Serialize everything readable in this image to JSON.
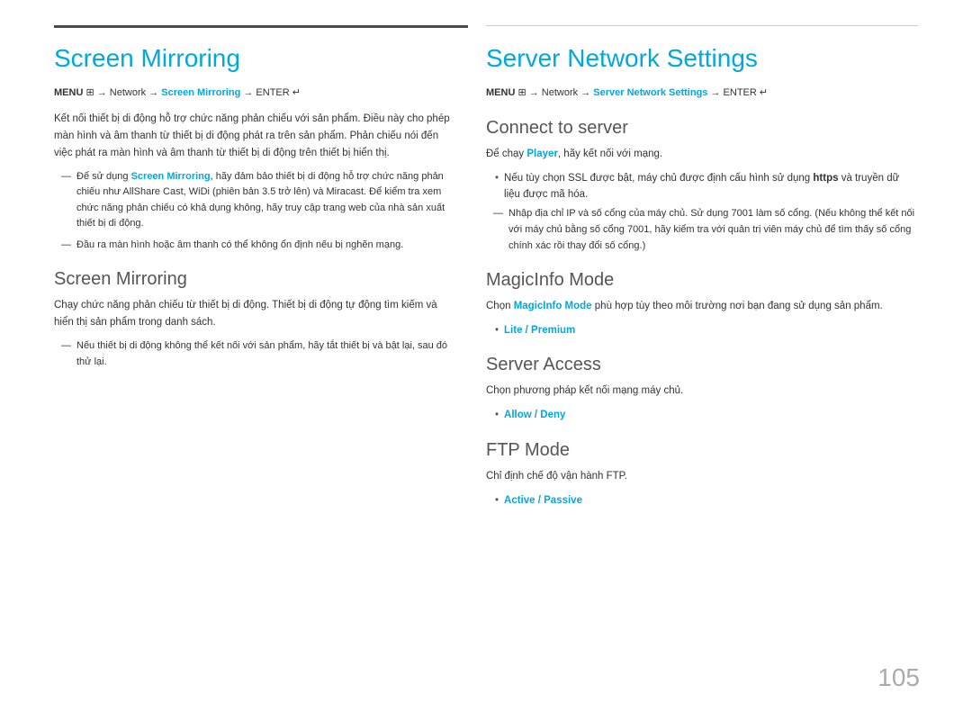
{
  "page": {
    "number": "105"
  },
  "left": {
    "top_bar_accent": true,
    "title": "Screen Mirroring",
    "menu_path": {
      "prefix": "MENU ",
      "menu_icon": "⊞",
      "path_parts": [
        "Network",
        "Screen Mirroring",
        "ENTER"
      ],
      "enter_icon": "↵"
    },
    "intro_text": "Kết nối thiết bị di động hỗ trợ chức năng phản chiếu với sản phẩm. Điều này cho phép màn hình và âm thanh từ thiết bị di động phát ra trên sản phẩm. Phản chiếu nói đến việc phát ra màn hình và âm thanh từ thiết bị di động trên thiết bị hiển thị.",
    "notes": [
      "Để sử dụng Screen Mirroring, hãy đảm bảo thiết bị di động hỗ trợ chức năng phản chiếu như AllShare Cast, WiDi (phiên bản 3.5 trở lên) và Miracast. Để kiểm tra xem chức năng phản chiếu có khả dụng không, hãy truy cập trang web của nhà sản xuất thiết bị di động.",
      "Đầu ra màn hình hoặc âm thanh có thể không ổn định nếu bị nghẽn mạng."
    ],
    "sub_section": {
      "title": "Screen Mirroring",
      "body": "Chạy chức năng phản chiếu từ thiết bị di động. Thiết bị di động tự động tìm kiếm và hiển thị sản phẩm trong danh sách.",
      "sub_note": "Nếu thiết bị di động không thể kết nối với sản phẩm, hãy tắt thiết bị và bật lại, sau đó thử lại."
    }
  },
  "right": {
    "title": "Server Network Settings",
    "menu_path": {
      "prefix": "MENU ",
      "menu_icon": "⊞",
      "path_parts": [
        "Network",
        "Server Network Settings",
        "ENTER"
      ],
      "enter_icon": "↵"
    },
    "sections": [
      {
        "id": "connect-to-server",
        "title": "Connect to server",
        "body": "Để chạy Player, hãy kết nối với mạng.",
        "notes": [
          {
            "type": "bullet",
            "text": "Nếu tùy chọn SSL được bật, máy chủ được định cấu hình sử dụng https và truyền dữ liệu được mã hóa."
          },
          {
            "type": "dash",
            "text": "Nhập địa chỉ IP và số cổng của máy chủ. Sử dụng 7001 làm số cổng. (Nếu không thể kết nối với máy chủ bằng số cổng 7001, hãy kiểm tra với quản trị viên máy chủ để tìm thấy số cổng chính xác rồi thay đổi số cổng.)"
          }
        ]
      },
      {
        "id": "magicinfo-mode",
        "title": "MagicInfo Mode",
        "body": "Chọn MagicInfo Mode phù hợp tùy theo môi trường nơi bạn đang sử dụng sản phẩm.",
        "options": "Lite / Premium"
      },
      {
        "id": "server-access",
        "title": "Server Access",
        "body": "Chọn phương pháp kết nối mạng máy chủ.",
        "options": "Allow / Deny"
      },
      {
        "id": "ftp-mode",
        "title": "FTP Mode",
        "body": "Chỉ định chế độ vận hành FTP.",
        "options": "Active / Passive"
      }
    ]
  }
}
